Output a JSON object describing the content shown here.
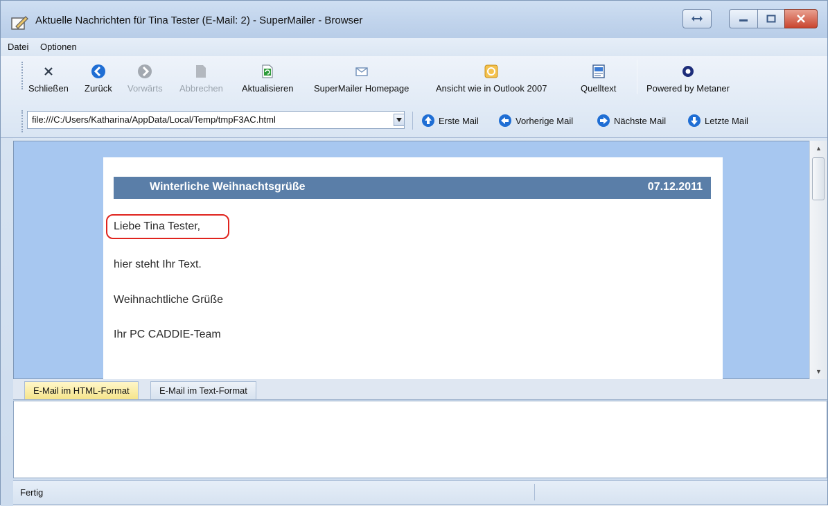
{
  "window": {
    "title": "Aktuelle Nachrichten für Tina Tester (E-Mail: 2) - SuperMailer - Browser"
  },
  "menu": [
    "Datei",
    "Optionen"
  ],
  "toolbar": {
    "close": "Schließen",
    "back": "Zurück",
    "forward": "Vorwärts",
    "cancel": "Abbrechen",
    "refresh": "Aktualisieren",
    "homepage": "SuperMailer Homepage",
    "outlook_view": "Ansicht wie in Outlook 2007",
    "source": "Quelltext",
    "powered": "Powered by Metaner"
  },
  "address": {
    "value": "file:///C:/Users/Katharina/AppData/Local/Temp/tmpF3AC.html"
  },
  "nav": {
    "first": "Erste Mail",
    "prev": "Vorherige Mail",
    "next": "Nächste Mail",
    "last": "Letzte Mail"
  },
  "mail": {
    "title": "Winterliche Weihnachtsgrüße",
    "date": "07.12.2011",
    "greeting": "Liebe Tina Tester,",
    "body": "hier steht Ihr Text.",
    "closing": "Weihnachtliche Grüße",
    "signature": "Ihr PC CADDIE-Team"
  },
  "tabs": {
    "html": "E-Mail im HTML-Format",
    "text": "E-Mail im Text-Format"
  },
  "status": {
    "text": "Fertig"
  },
  "colors": {
    "accent": "#5a7ea8",
    "content_bg": "#a7c7f0",
    "highlight": "#e0241e",
    "nav_icon": "#1f6ed4"
  }
}
